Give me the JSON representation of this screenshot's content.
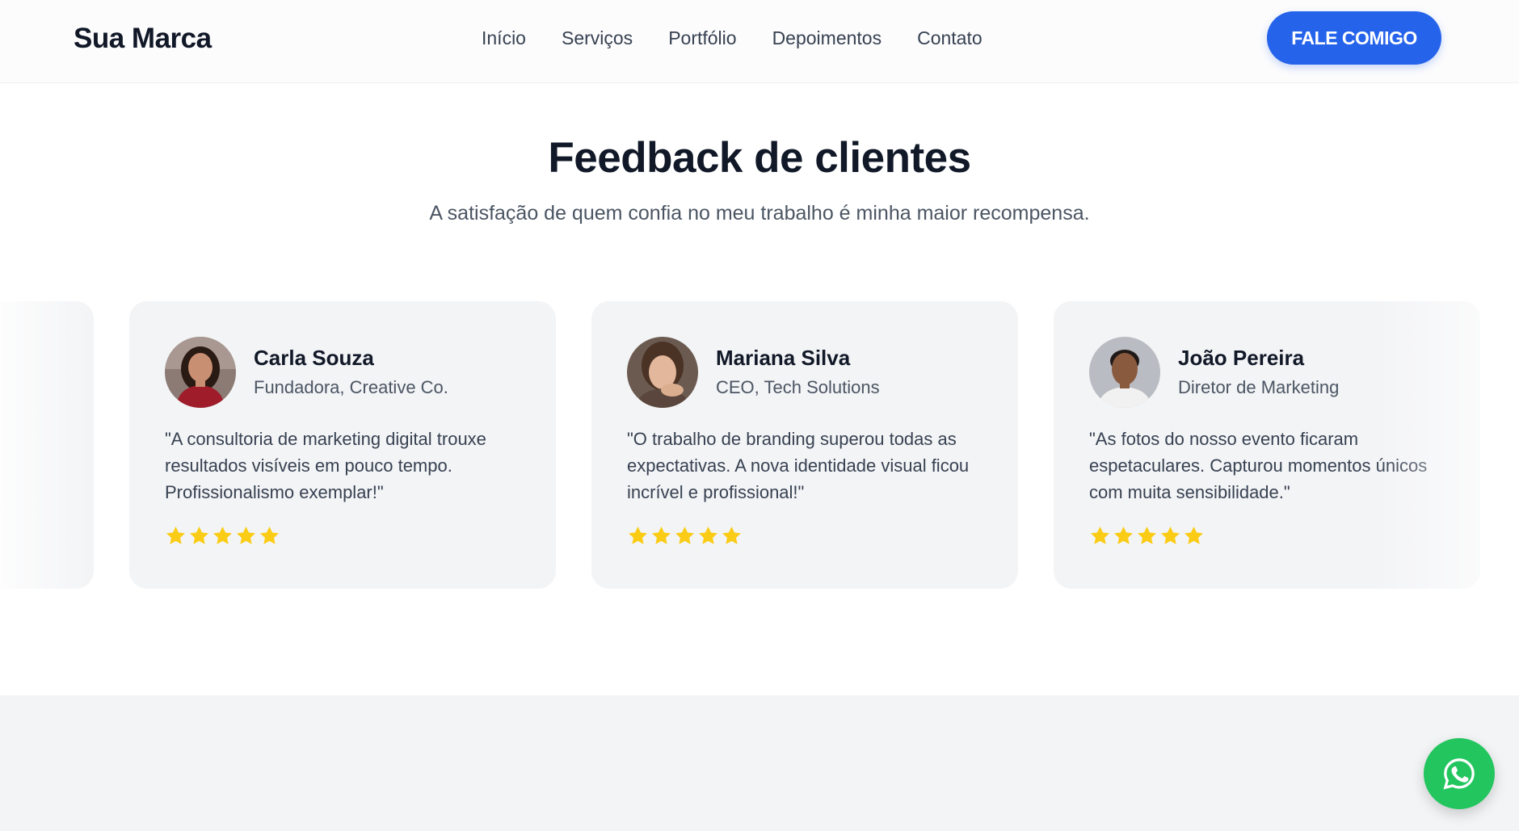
{
  "header": {
    "logo": "Sua Marca",
    "nav": [
      "Início",
      "Serviços",
      "Portfólio",
      "Depoimentos",
      "Contato"
    ],
    "cta_label": "FALE COMIGO"
  },
  "section": {
    "title": "Feedback de clientes",
    "subtitle": "A satisfação de quem confia no meu trabalho é minha maior recompensa."
  },
  "testimonials": [
    {
      "name": "Carla Souza",
      "role": "Fundadora, Creative Co.",
      "quote": "\"A consultoria de marketing digital trouxe resultados visíveis em pouco tempo. Profissionalismo exemplar!\"",
      "rating": 5
    },
    {
      "name": "Mariana Silva",
      "role": "CEO, Tech Solutions",
      "quote": "\"O trabalho de branding superou todas as expectativas. A nova identidade visual ficou incrível e profissional!\"",
      "rating": 5
    },
    {
      "name": "João Pereira",
      "role": "Diretor de Marketing",
      "quote": "\"As fotos do nosso evento ficaram espetaculares. Capturou momentos únicos com muita sensibilidade.\"",
      "rating": 5
    }
  ],
  "colors": {
    "accent": "#2563eb",
    "star": "#facc15",
    "whatsapp": "#22c55e",
    "card_bg": "#f3f4f6"
  },
  "icons": {
    "star": "star-icon",
    "whatsapp": "whatsapp-icon"
  }
}
